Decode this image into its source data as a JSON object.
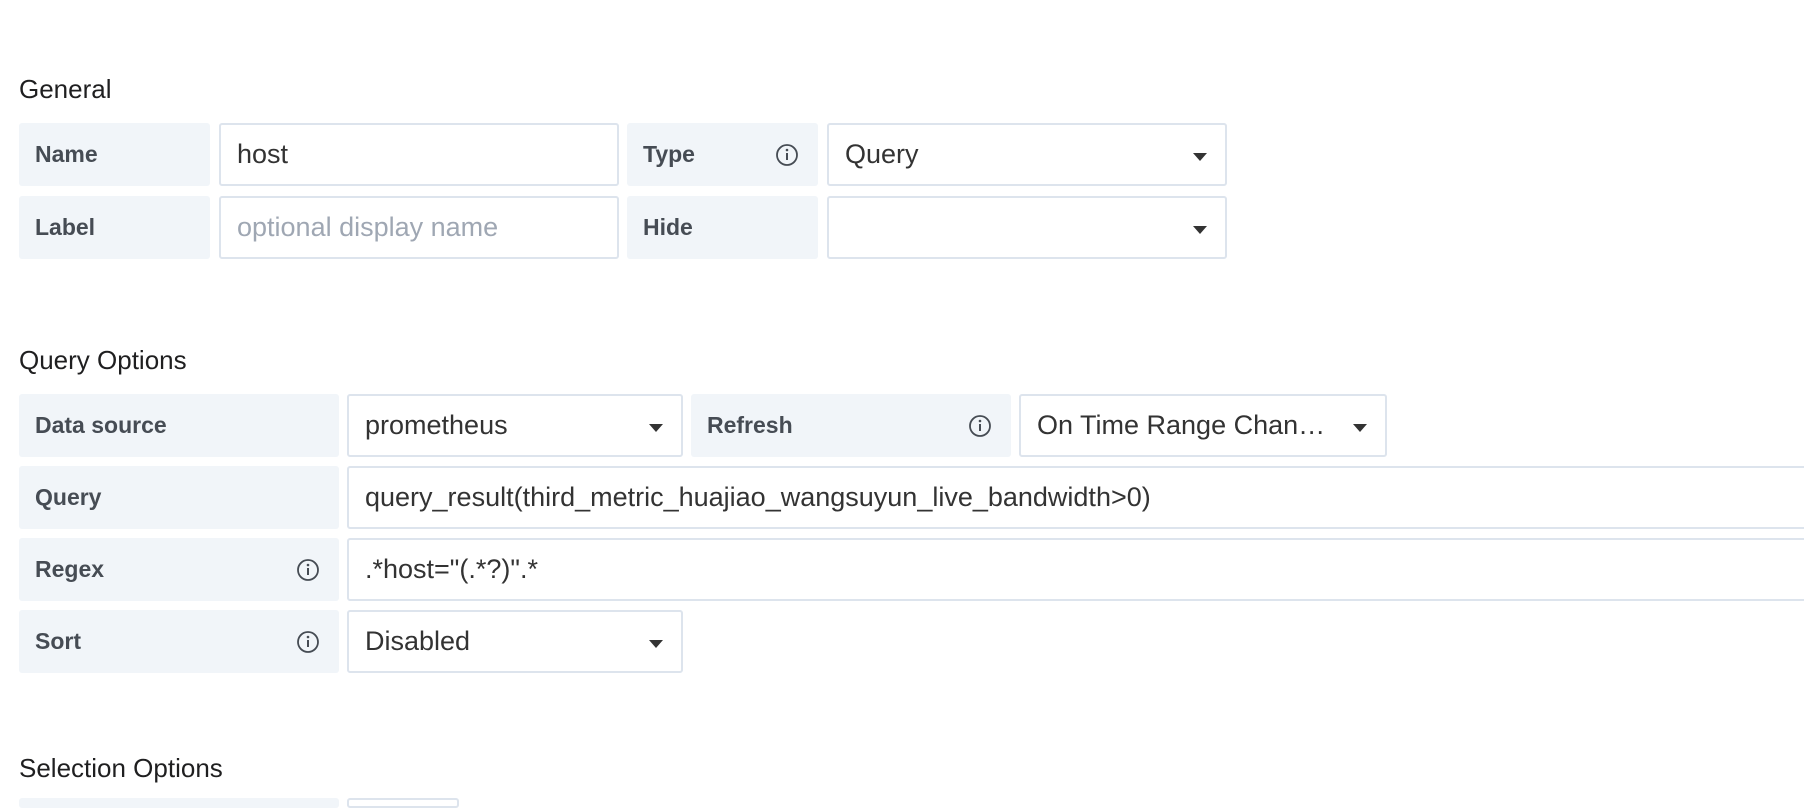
{
  "general": {
    "title": "General",
    "name_label": "Name",
    "name_value": "host",
    "type_label": "Type",
    "type_value": "Query",
    "label_label": "Label",
    "label_placeholder": "optional display name",
    "hide_label": "Hide",
    "hide_value": ""
  },
  "query_options": {
    "title": "Query Options",
    "datasource_label": "Data source",
    "datasource_value": "prometheus",
    "refresh_label": "Refresh",
    "refresh_value": "On Time Range Chan…",
    "query_label": "Query",
    "query_value": "query_result(third_metric_huajiao_wangsuyun_live_bandwidth>0)",
    "regex_label": "Regex",
    "regex_value": ".*host=\"(.*?)\".*",
    "sort_label": "Sort",
    "sort_value": "Disabled"
  },
  "selection_options": {
    "title": "Selection Options"
  },
  "icons": {
    "info": "info-circle-icon",
    "dropdown": "caret-down-icon"
  },
  "colors": {
    "label_bg": "#f1f5f9",
    "border": "#dde4ed",
    "placeholder": "#9fa7b3"
  }
}
